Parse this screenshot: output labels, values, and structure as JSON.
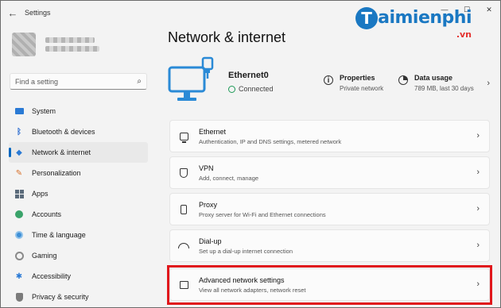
{
  "window": {
    "title": "Settings",
    "controls": [
      "—",
      "☐",
      "✕"
    ]
  },
  "watermark": {
    "brand": "aimienphi",
    "tld": ".vn"
  },
  "search": {
    "placeholder": "Find a setting"
  },
  "sidebar": {
    "items": [
      {
        "label": "System",
        "icon": "system-icon"
      },
      {
        "label": "Bluetooth & devices",
        "icon": "bluetooth-icon"
      },
      {
        "label": "Network & internet",
        "icon": "network-icon",
        "active": true
      },
      {
        "label": "Personalization",
        "icon": "brush-icon"
      },
      {
        "label": "Apps",
        "icon": "apps-icon"
      },
      {
        "label": "Accounts",
        "icon": "accounts-icon"
      },
      {
        "label": "Time & language",
        "icon": "globe-clock-icon"
      },
      {
        "label": "Gaming",
        "icon": "gaming-icon"
      },
      {
        "label": "Accessibility",
        "icon": "accessibility-icon"
      },
      {
        "label": "Privacy & security",
        "icon": "shield-icon"
      }
    ]
  },
  "main": {
    "title": "Network & internet",
    "connection": {
      "name": "Ethernet0",
      "status": "Connected"
    },
    "properties": {
      "title": "Properties",
      "subtitle": "Private network"
    },
    "data_usage": {
      "title": "Data usage",
      "subtitle": "789 MB, last 30 days"
    },
    "cards": [
      {
        "title": "Ethernet",
        "subtitle": "Authentication, IP and DNS settings, metered network"
      },
      {
        "title": "VPN",
        "subtitle": "Add, connect, manage"
      },
      {
        "title": "Proxy",
        "subtitle": "Proxy server for Wi-Fi and Ethernet connections"
      },
      {
        "title": "Dial-up",
        "subtitle": "Set up a dial-up internet connection"
      },
      {
        "title": "Advanced network settings",
        "subtitle": "View all network adapters, network reset"
      }
    ]
  },
  "colors": {
    "accent": "#0067c0",
    "highlight": "#e0161b",
    "hero_icon": "#2a8ad6"
  }
}
